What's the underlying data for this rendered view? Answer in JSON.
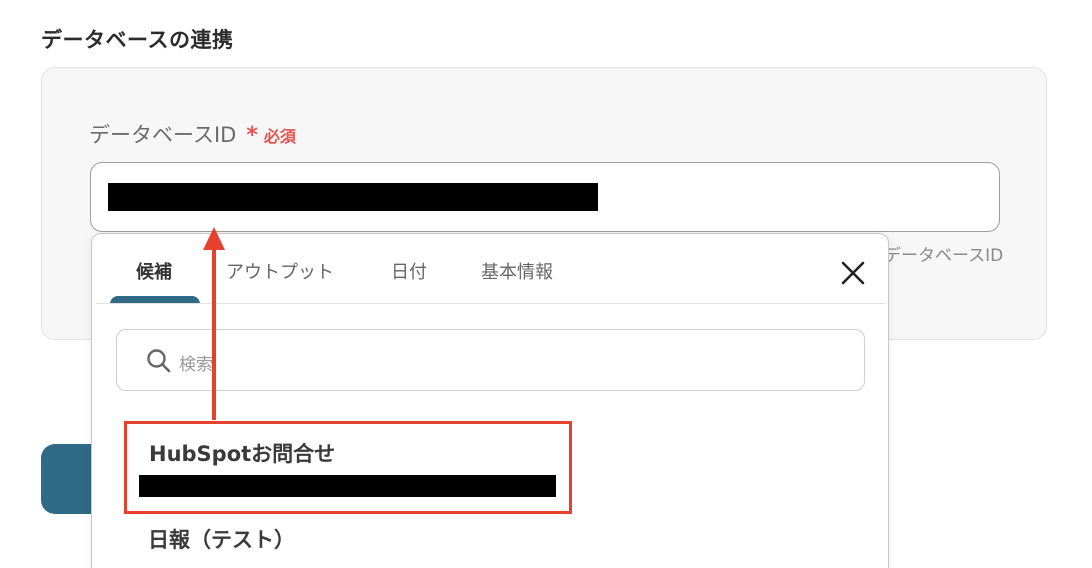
{
  "section": {
    "title": "データベースの連携"
  },
  "field": {
    "label": "データベースID",
    "required_mark": "*",
    "required_text": "必須",
    "hint": "データベースID"
  },
  "dropdown": {
    "tabs": [
      {
        "label": "候補",
        "active": true
      },
      {
        "label": "アウトプット",
        "active": false
      },
      {
        "label": "日付",
        "active": false
      },
      {
        "label": "基本情報",
        "active": false
      }
    ],
    "search_placeholder": "検索",
    "options": [
      {
        "title": "HubSpotお問合せ",
        "highlighted": true
      },
      {
        "title": "日報（テスト）",
        "highlighted": false
      }
    ]
  },
  "colors": {
    "accent": "#2f6a86",
    "required": "#e6534f",
    "highlight_border": "#e5412d"
  }
}
